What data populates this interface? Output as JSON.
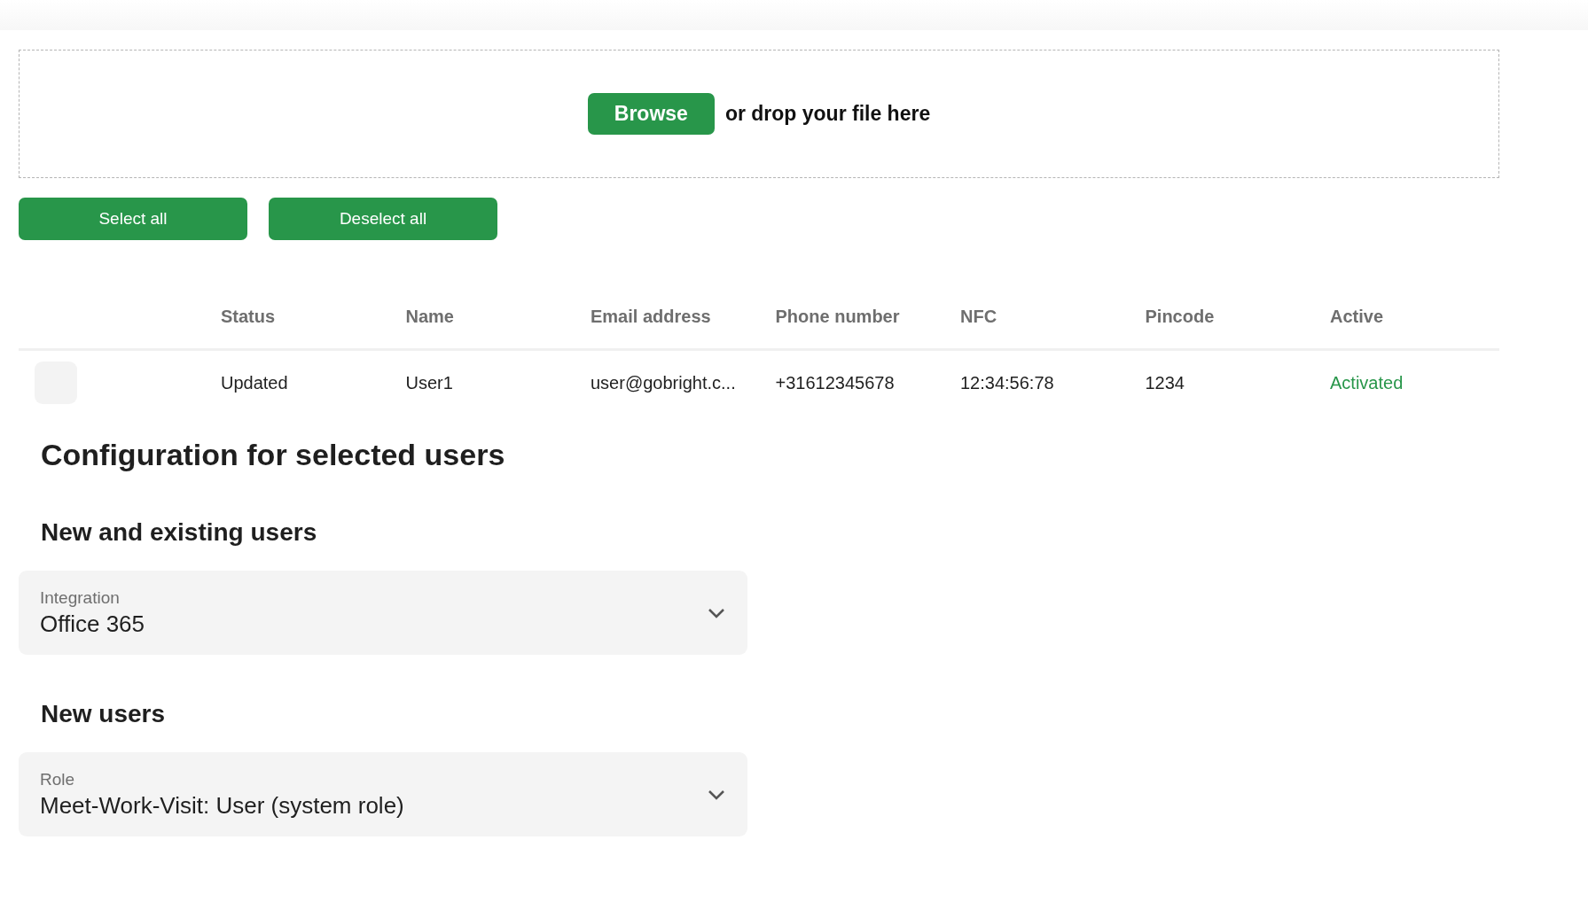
{
  "upload": {
    "button": "Browse",
    "hint": "or drop your file here"
  },
  "actions": [
    "Select all",
    "Deselect all"
  ],
  "table": {
    "columns": [
      "Status",
      "Name",
      "Email address",
      "Phone number",
      "NFC",
      "Pincode",
      "Active"
    ],
    "rows": [
      {
        "checked": false,
        "cells": [
          "Updated",
          "User1",
          "user@gobright.c...",
          "+31612345678",
          "12:34:56:78",
          "1234"
        ],
        "active": {
          "text": "Activated",
          "on": true
        }
      }
    ]
  },
  "configuration": {
    "title": "Configuration for selected users",
    "sections": [
      {
        "title": "New and existing users",
        "field": {
          "label": "Integration",
          "value": "Office 365"
        }
      },
      {
        "title": "New users",
        "field": {
          "label": "Role",
          "value": "Meet-Work-Visit: User (system role)"
        }
      }
    ]
  }
}
